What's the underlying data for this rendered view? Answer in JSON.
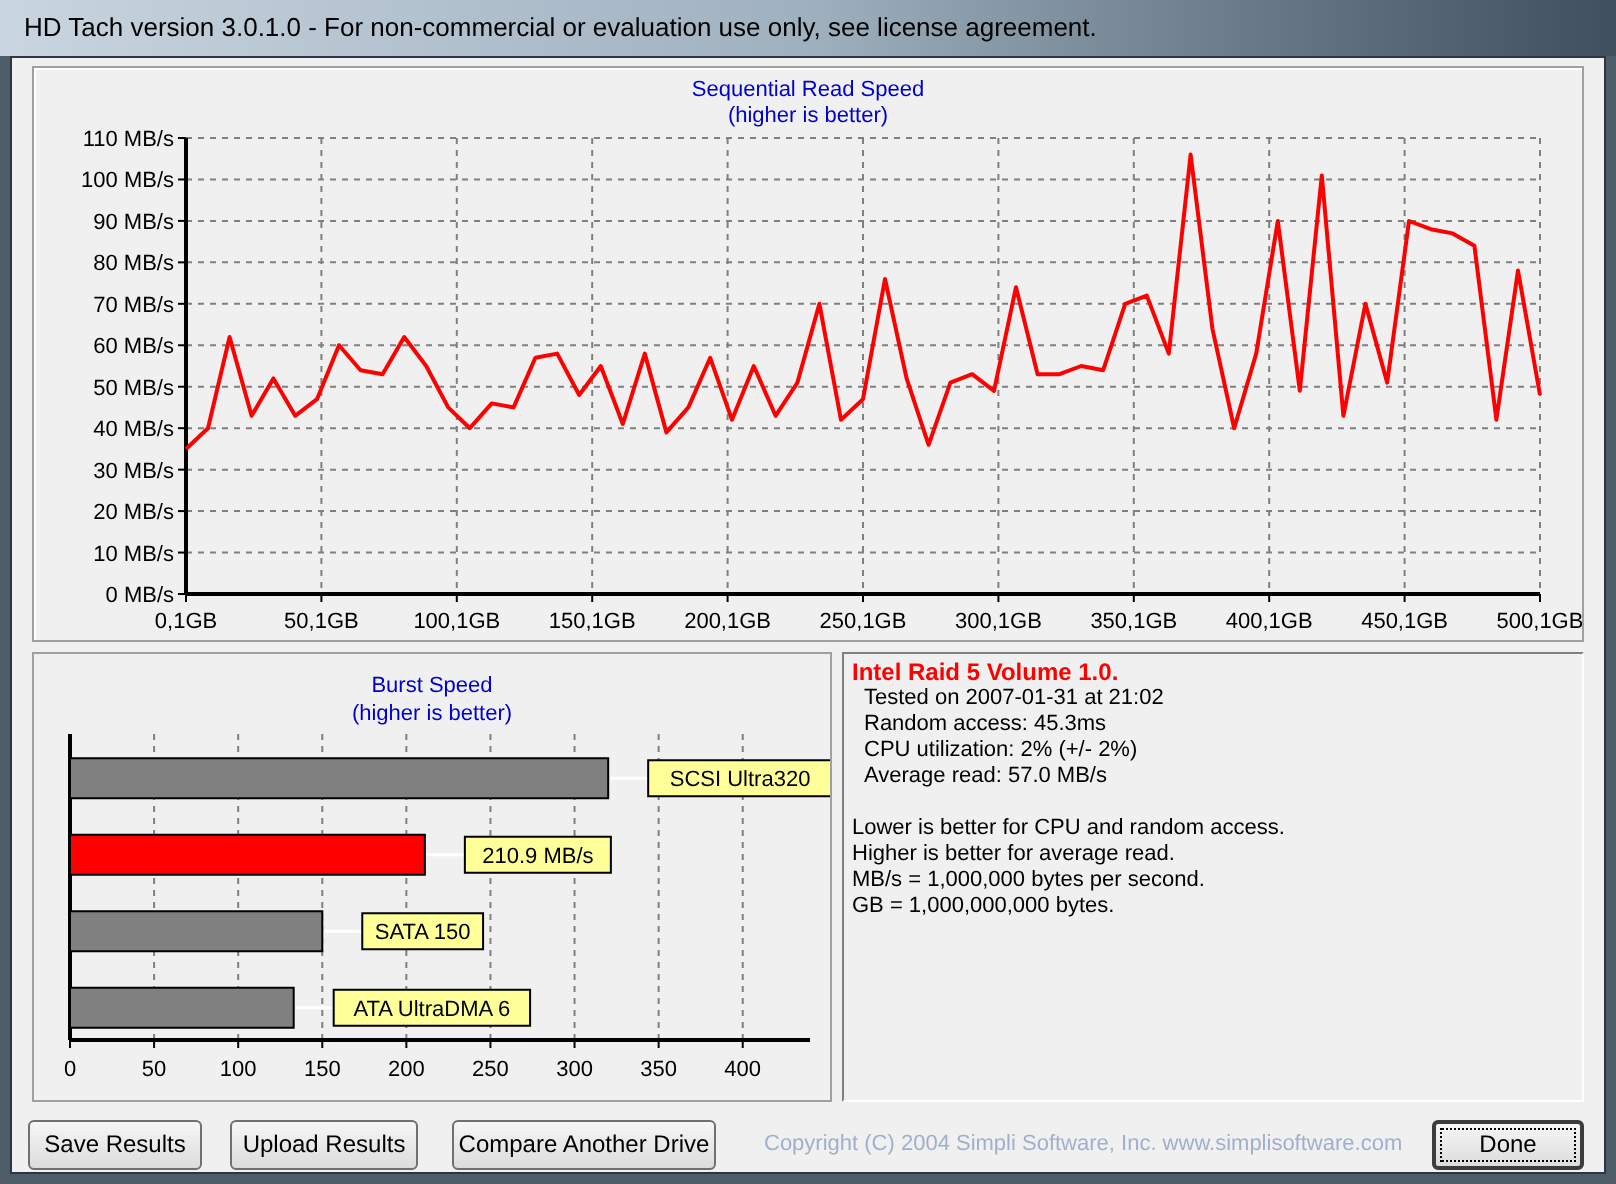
{
  "window": {
    "title": "HD Tach version 3.0.1.0  - For non-commercial or evaluation use only, see license agreement."
  },
  "sequential": {
    "title": "Sequential Read Speed",
    "subtitle": "(higher is better)",
    "chart_data": {
      "type": "line",
      "x": [
        0.1,
        8.2,
        16.2,
        24.3,
        32.4,
        40.4,
        48.5,
        56.6,
        64.6,
        72.7,
        80.7,
        88.8,
        96.9,
        104.9,
        113.0,
        121.1,
        129.1,
        137.2,
        145.3,
        153.3,
        161.4,
        169.5,
        177.5,
        185.6,
        193.7,
        201.7,
        209.8,
        217.8,
        225.9,
        234.0,
        242.0,
        250.1,
        258.2,
        266.2,
        274.3,
        282.4,
        290.4,
        298.5,
        306.6,
        314.6,
        322.7,
        330.7,
        338.8,
        346.9,
        354.9,
        363.0,
        371.1,
        379.1,
        387.2,
        395.3,
        403.3,
        411.4,
        419.5,
        427.5,
        435.6,
        443.7,
        451.7,
        459.8,
        467.8,
        475.9,
        484.0,
        492.0,
        500.1
      ],
      "grid": true,
      "series": [
        {
          "color": "#ff0000",
          "values": [
            35,
            40,
            62,
            43,
            52,
            43,
            47,
            60,
            54,
            53,
            62,
            55,
            45,
            40,
            46,
            45,
            57,
            58,
            48,
            55,
            41,
            58,
            39,
            45,
            57,
            42,
            55,
            43,
            51,
            70,
            42,
            47,
            76,
            52,
            36,
            51,
            53,
            49,
            74,
            53,
            53,
            55,
            54,
            70,
            72,
            58,
            106,
            64,
            40,
            58,
            90,
            49,
            101,
            43,
            70,
            51,
            90,
            88,
            87,
            84,
            42,
            78,
            48
          ]
        }
      ],
      "xlim": [
        0.1,
        500.1
      ],
      "ylim": [
        0,
        110
      ],
      "xticks": [
        {
          "value": 0.1,
          "label": "0,1GB"
        },
        {
          "value": 50.1,
          "label": "50,1GB"
        },
        {
          "value": 100.1,
          "label": "100,1GB"
        },
        {
          "value": 150.1,
          "label": "150,1GB"
        },
        {
          "value": 200.1,
          "label": "200,1GB"
        },
        {
          "value": 250.1,
          "label": "250,1GB"
        },
        {
          "value": 300.1,
          "label": "300,1GB"
        },
        {
          "value": 350.1,
          "label": "350,1GB"
        },
        {
          "value": 400.1,
          "label": "400,1GB"
        },
        {
          "value": 450.1,
          "label": "450,1GB"
        },
        {
          "value": 500.1,
          "label": "500,1GB"
        }
      ],
      "yticks": [
        {
          "value": 0,
          "label": "0 MB/s"
        },
        {
          "value": 10,
          "label": "10 MB/s"
        },
        {
          "value": 20,
          "label": "20 MB/s"
        },
        {
          "value": 30,
          "label": "30 MB/s"
        },
        {
          "value": 40,
          "label": "40 MB/s"
        },
        {
          "value": 50,
          "label": "50 MB/s"
        },
        {
          "value": 60,
          "label": "60 MB/s"
        },
        {
          "value": 70,
          "label": "70 MB/s"
        },
        {
          "value": 80,
          "label": "80 MB/s"
        },
        {
          "value": 90,
          "label": "90 MB/s"
        },
        {
          "value": 100,
          "label": "100 MB/s"
        },
        {
          "value": 110,
          "label": "110 MB/s"
        }
      ]
    }
  },
  "burst": {
    "title": "Burst Speed",
    "subtitle": "(higher is better)",
    "chart_data": {
      "type": "bar",
      "orientation": "horizontal",
      "categories": [
        "SCSI Ultra320",
        "210.9 MB/s",
        "SATA 150",
        "ATA UltraDMA 6"
      ],
      "grid": true,
      "series": [
        {
          "color": "#808080",
          "values": [
            320,
            null,
            150,
            133
          ]
        },
        {
          "color": "#ff0000",
          "values": [
            null,
            211,
            null,
            null
          ]
        }
      ],
      "xlim": [
        0,
        440
      ],
      "xticks": [
        0,
        50,
        100,
        150,
        200,
        250,
        300,
        350,
        400
      ]
    }
  },
  "info": {
    "title": "Intel Raid 5 Volume 1.0.",
    "details": [
      "Tested on 2007-01-31 at 21:02",
      "Random access: 45.3ms",
      "CPU utilization: 2% (+/- 2%)",
      "Average read: 57.0 MB/s"
    ],
    "notes": [
      "Lower is better for CPU and random access.",
      "Higher is better for average read.",
      "MB/s = 1,000,000 bytes per second.",
      "GB = 1,000,000,000 bytes."
    ]
  },
  "buttons": [
    {
      "label": "Save Results",
      "default": false
    },
    {
      "label": "Upload Results",
      "default": false
    },
    {
      "label": "Compare Another Drive",
      "default": false
    }
  ],
  "copyright": "Copyright (C) 2004 Simpli Software, Inc. www.simplisoftware.com",
  "done_button": {
    "label": "Done",
    "default": true
  }
}
